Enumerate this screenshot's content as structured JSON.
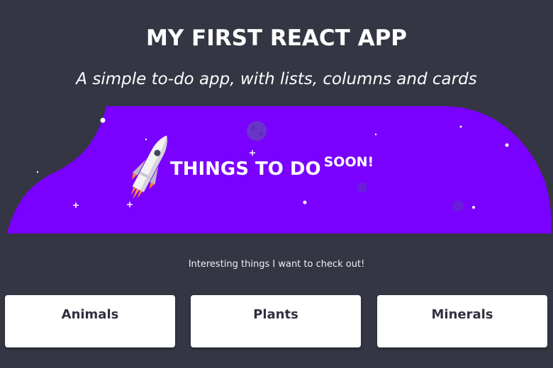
{
  "header": {
    "title": "MY FIRST REACT APP",
    "subtitle": "A simple to-do app, with lists, columns and cards"
  },
  "hero": {
    "heading": "THINGS TO DO",
    "heading_sup": "SOON!",
    "icon": "rocket-icon",
    "colors": {
      "background": "#7a00ff",
      "page": "#343643"
    }
  },
  "list": {
    "description": "Interesting things I want to check out!",
    "columns": [
      {
        "title": "Animals"
      },
      {
        "title": "Plants"
      },
      {
        "title": "Minerals"
      }
    ]
  }
}
